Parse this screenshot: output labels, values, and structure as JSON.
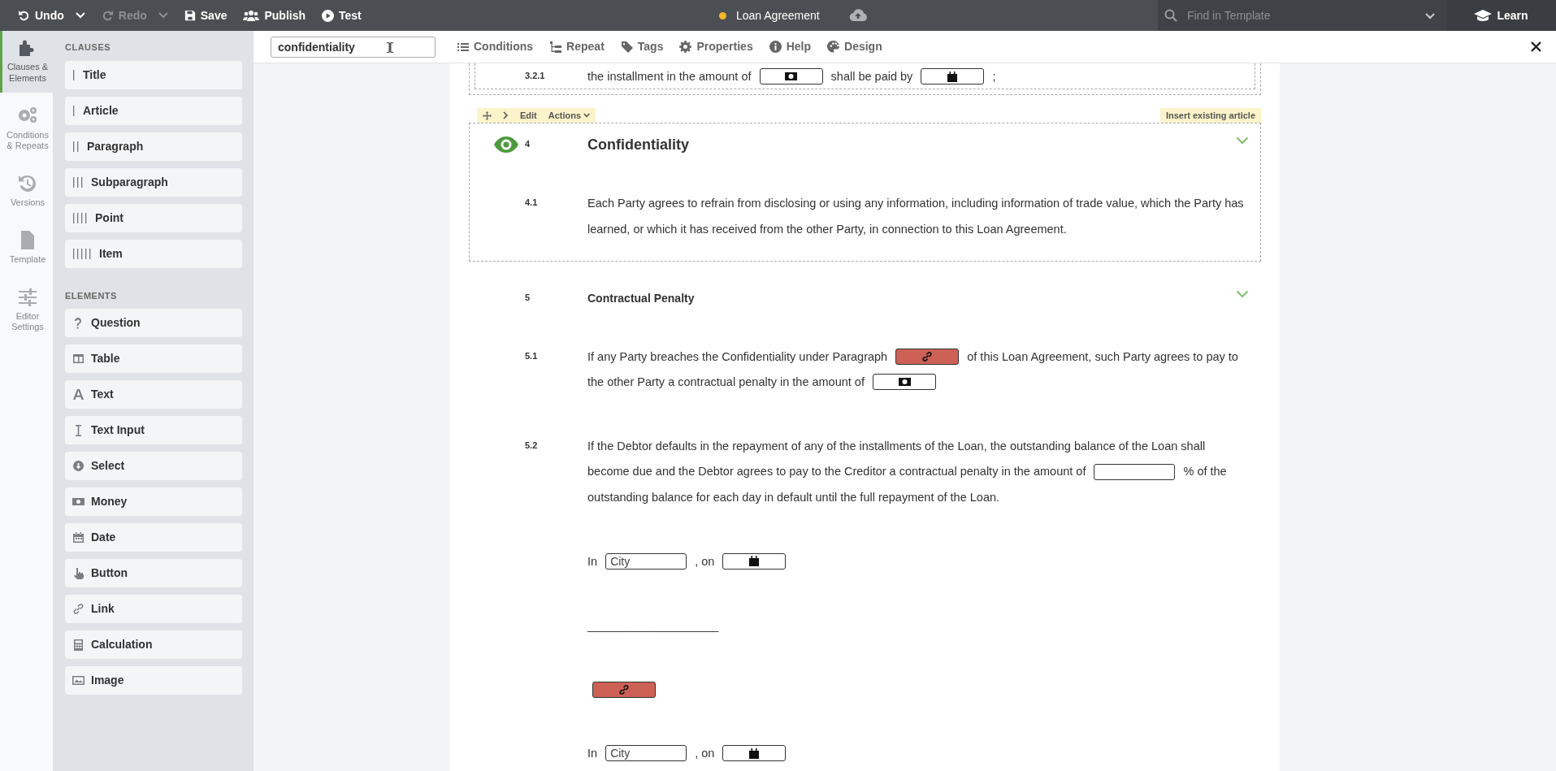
{
  "topbar": {
    "actions": [
      {
        "kind": "undo",
        "label": "Undo",
        "disabled": false,
        "caret": true
      },
      {
        "kind": "redo",
        "label": "Redo",
        "disabled": true,
        "caret": true
      },
      {
        "kind": "save",
        "label": "Save",
        "disabled": false,
        "caret": false
      },
      {
        "kind": "publish",
        "label": "Publish",
        "disabled": false,
        "caret": false
      },
      {
        "kind": "test",
        "label": "Test",
        "disabled": false,
        "caret": false
      }
    ],
    "document_title": "Loan Agreement",
    "unsaved": true,
    "search": {
      "placeholder": "Find in Template"
    },
    "learn": "Learn"
  },
  "toolbar": {
    "search_value": "confidentiality",
    "tools": [
      {
        "kind": "conditions",
        "label": "Conditions"
      },
      {
        "kind": "repeat",
        "label": "Repeat"
      },
      {
        "kind": "tags",
        "label": "Tags"
      },
      {
        "kind": "properties",
        "label": "Properties"
      },
      {
        "kind": "help",
        "label": "Help"
      },
      {
        "kind": "design",
        "label": "Design"
      }
    ]
  },
  "rail": [
    {
      "kind": "clauses",
      "label": "Clauses & Elements",
      "selected": true
    },
    {
      "kind": "conditions",
      "label": "Conditions & Repeats",
      "selected": false
    },
    {
      "kind": "versions",
      "label": "Versions",
      "selected": false
    },
    {
      "kind": "template",
      "label": "Template",
      "selected": false
    },
    {
      "kind": "settings",
      "label": "Editor Settings",
      "selected": false
    }
  ],
  "panel": [
    {
      "title": "CLAUSES",
      "items": [
        {
          "kind": "title",
          "label": "Title"
        },
        {
          "kind": "article",
          "label": "Article"
        },
        {
          "kind": "paragraph",
          "label": "Paragraph"
        },
        {
          "kind": "subparagraph",
          "label": "Subparagraph"
        },
        {
          "kind": "point",
          "label": "Point"
        },
        {
          "kind": "item",
          "label": "Item"
        }
      ]
    },
    {
      "title": "ELEMENTS",
      "items": [
        {
          "kind": "question",
          "label": "Question"
        },
        {
          "kind": "table",
          "label": "Table"
        },
        {
          "kind": "text",
          "label": "Text"
        },
        {
          "kind": "textinput",
          "label": "Text Input"
        },
        {
          "kind": "select",
          "label": "Select"
        },
        {
          "kind": "money",
          "label": "Money"
        },
        {
          "kind": "date",
          "label": "Date"
        },
        {
          "kind": "button",
          "label": "Button"
        },
        {
          "kind": "link",
          "label": "Link"
        },
        {
          "kind": "calculation",
          "label": "Calculation"
        },
        {
          "kind": "image",
          "label": "Image"
        }
      ]
    }
  ],
  "document": {
    "blocks": [
      {
        "kind": "clause_box",
        "number": "3.2.1",
        "parts": [
          {
            "kind": "text",
            "text": "the installment in the amount of"
          },
          {
            "kind": "money"
          },
          {
            "kind": "text",
            "text": "shall be paid by"
          },
          {
            "kind": "date"
          },
          {
            "kind": "text",
            "text": ";"
          }
        ]
      },
      {
        "kind": "article",
        "selected": true,
        "number": "4",
        "title": "Confidentiality",
        "toolbar": {
          "edit": "Edit",
          "actions": "Actions",
          "insert": "Insert existing article"
        },
        "clauses": [
          {
            "number": "4.1",
            "parts": [
              {
                "kind": "text",
                "text": "Each Party agrees to refrain from disclosing or using any information, including information of trade value, which the Party has learned, or which it has received from the other Party, in connection to this Loan Agreement."
              }
            ]
          }
        ]
      },
      {
        "kind": "article",
        "selected": false,
        "number": "5",
        "title": "Contractual Penalty",
        "clauses": [
          {
            "number": "5.1",
            "parts": [
              {
                "kind": "text",
                "text": "If any Party breaches the Confidentiality under Paragraph"
              },
              {
                "kind": "link"
              },
              {
                "kind": "text",
                "text": "of this Loan Agreement, such Party agrees to pay to the other Party a contractual penalty in the amount of"
              },
              {
                "kind": "money"
              }
            ]
          },
          {
            "number": "5.2",
            "parts": [
              {
                "kind": "text",
                "text": "If the Debtor defaults in the repayment of any of the installments of the Loan, the outstanding balance of the Loan shall become due and the Debtor agrees to pay to the Creditor a contractual penalty in the amount of"
              },
              {
                "kind": "blank"
              },
              {
                "kind": "text",
                "text": "% of the outstanding balance for each day in default until the full repayment of the Loan."
              }
            ]
          }
        ]
      },
      {
        "kind": "line",
        "parts": [
          {
            "kind": "text",
            "text": "In"
          },
          {
            "kind": "input",
            "placeholder": "City"
          },
          {
            "kind": "text",
            "text": ", on"
          },
          {
            "kind": "date"
          }
        ]
      },
      {
        "kind": "line",
        "parts": [
          {
            "kind": "text",
            "text": "____________________"
          }
        ]
      },
      {
        "kind": "line",
        "parts": [
          {
            "kind": "link"
          }
        ]
      },
      {
        "kind": "line",
        "parts": [
          {
            "kind": "text",
            "text": "In"
          },
          {
            "kind": "input",
            "placeholder": "City"
          },
          {
            "kind": "text",
            "text": ", on"
          },
          {
            "kind": "date"
          }
        ]
      }
    ]
  }
}
